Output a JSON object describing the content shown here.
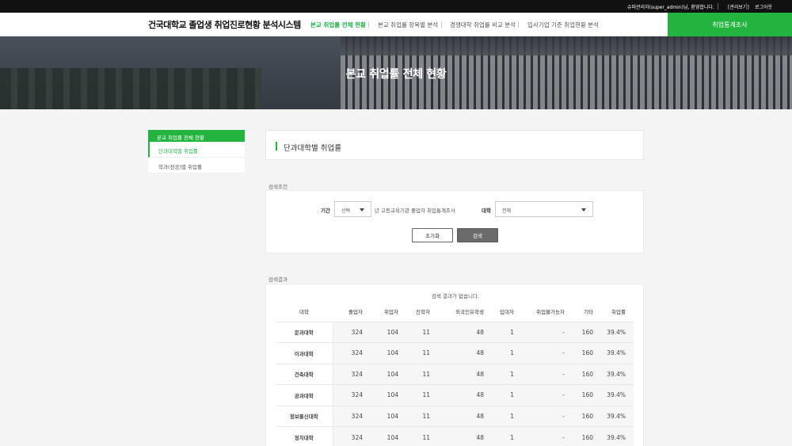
{
  "topbar": {
    "user_name": "슈퍼관리자(super_admin)",
    "welcome_suffix": "님, 환영합니다.",
    "admin_link": "[관리보기]",
    "logout": "로그아웃"
  },
  "header": {
    "site_title": "건국대학교 졸업생 취업진로현황 분석시스템",
    "nav": [
      {
        "label": "본교 취업률 전체 현황",
        "active": true
      },
      {
        "label": "본교 취업률 항목별 분석",
        "active": false
      },
      {
        "label": "경쟁대학 취업률 비교 분석",
        "active": false
      },
      {
        "label": "입사기업 기준 취업현황 분석",
        "active": false
      }
    ],
    "stats_button": "취업통계조사"
  },
  "hero": {
    "title": "본교 취업률 전체 현황"
  },
  "sidebar": {
    "heading": "본교 취업률 전체 현황",
    "items": [
      {
        "label": "단과대학별 취업률",
        "active": true
      },
      {
        "label": "학과(전공)별 취업률",
        "active": false
      }
    ]
  },
  "page": {
    "title": "단과대학별 취업률",
    "search_label": "검색조건",
    "result_label": "검색결과"
  },
  "search": {
    "period_label": "기간",
    "period_value": "선택",
    "period_note": "년 고등교육기관 졸업자 취업통계조사",
    "college_label": "대학",
    "college_value": "전체",
    "reset_button": "초기화",
    "search_button": "검색"
  },
  "results": {
    "empty_message": "검색 결과가 없습니다.",
    "columns": [
      "대학",
      "졸업자",
      "취업자",
      "진학자",
      "외국인유학생",
      "입대자",
      "취업불가능자",
      "기타",
      "취업률"
    ],
    "rows": [
      [
        "문과대학",
        "324",
        "104",
        "11",
        "48",
        "1",
        "-",
        "160",
        "39.4%"
      ],
      [
        "이과대학",
        "324",
        "104",
        "11",
        "48",
        "1",
        "-",
        "160",
        "39.4%"
      ],
      [
        "건축대학",
        "324",
        "104",
        "11",
        "48",
        "1",
        "-",
        "160",
        "39.4%"
      ],
      [
        "공과대학",
        "324",
        "104",
        "11",
        "48",
        "1",
        "-",
        "160",
        "39.4%"
      ],
      [
        "정보통신대학",
        "324",
        "104",
        "11",
        "48",
        "1",
        "-",
        "160",
        "39.4%"
      ],
      [
        "정치대학",
        "324",
        "104",
        "11",
        "48",
        "1",
        "-",
        "160",
        "39.4%"
      ]
    ]
  },
  "colors": {
    "accent": "#22b43f",
    "topbar": "#111111"
  }
}
